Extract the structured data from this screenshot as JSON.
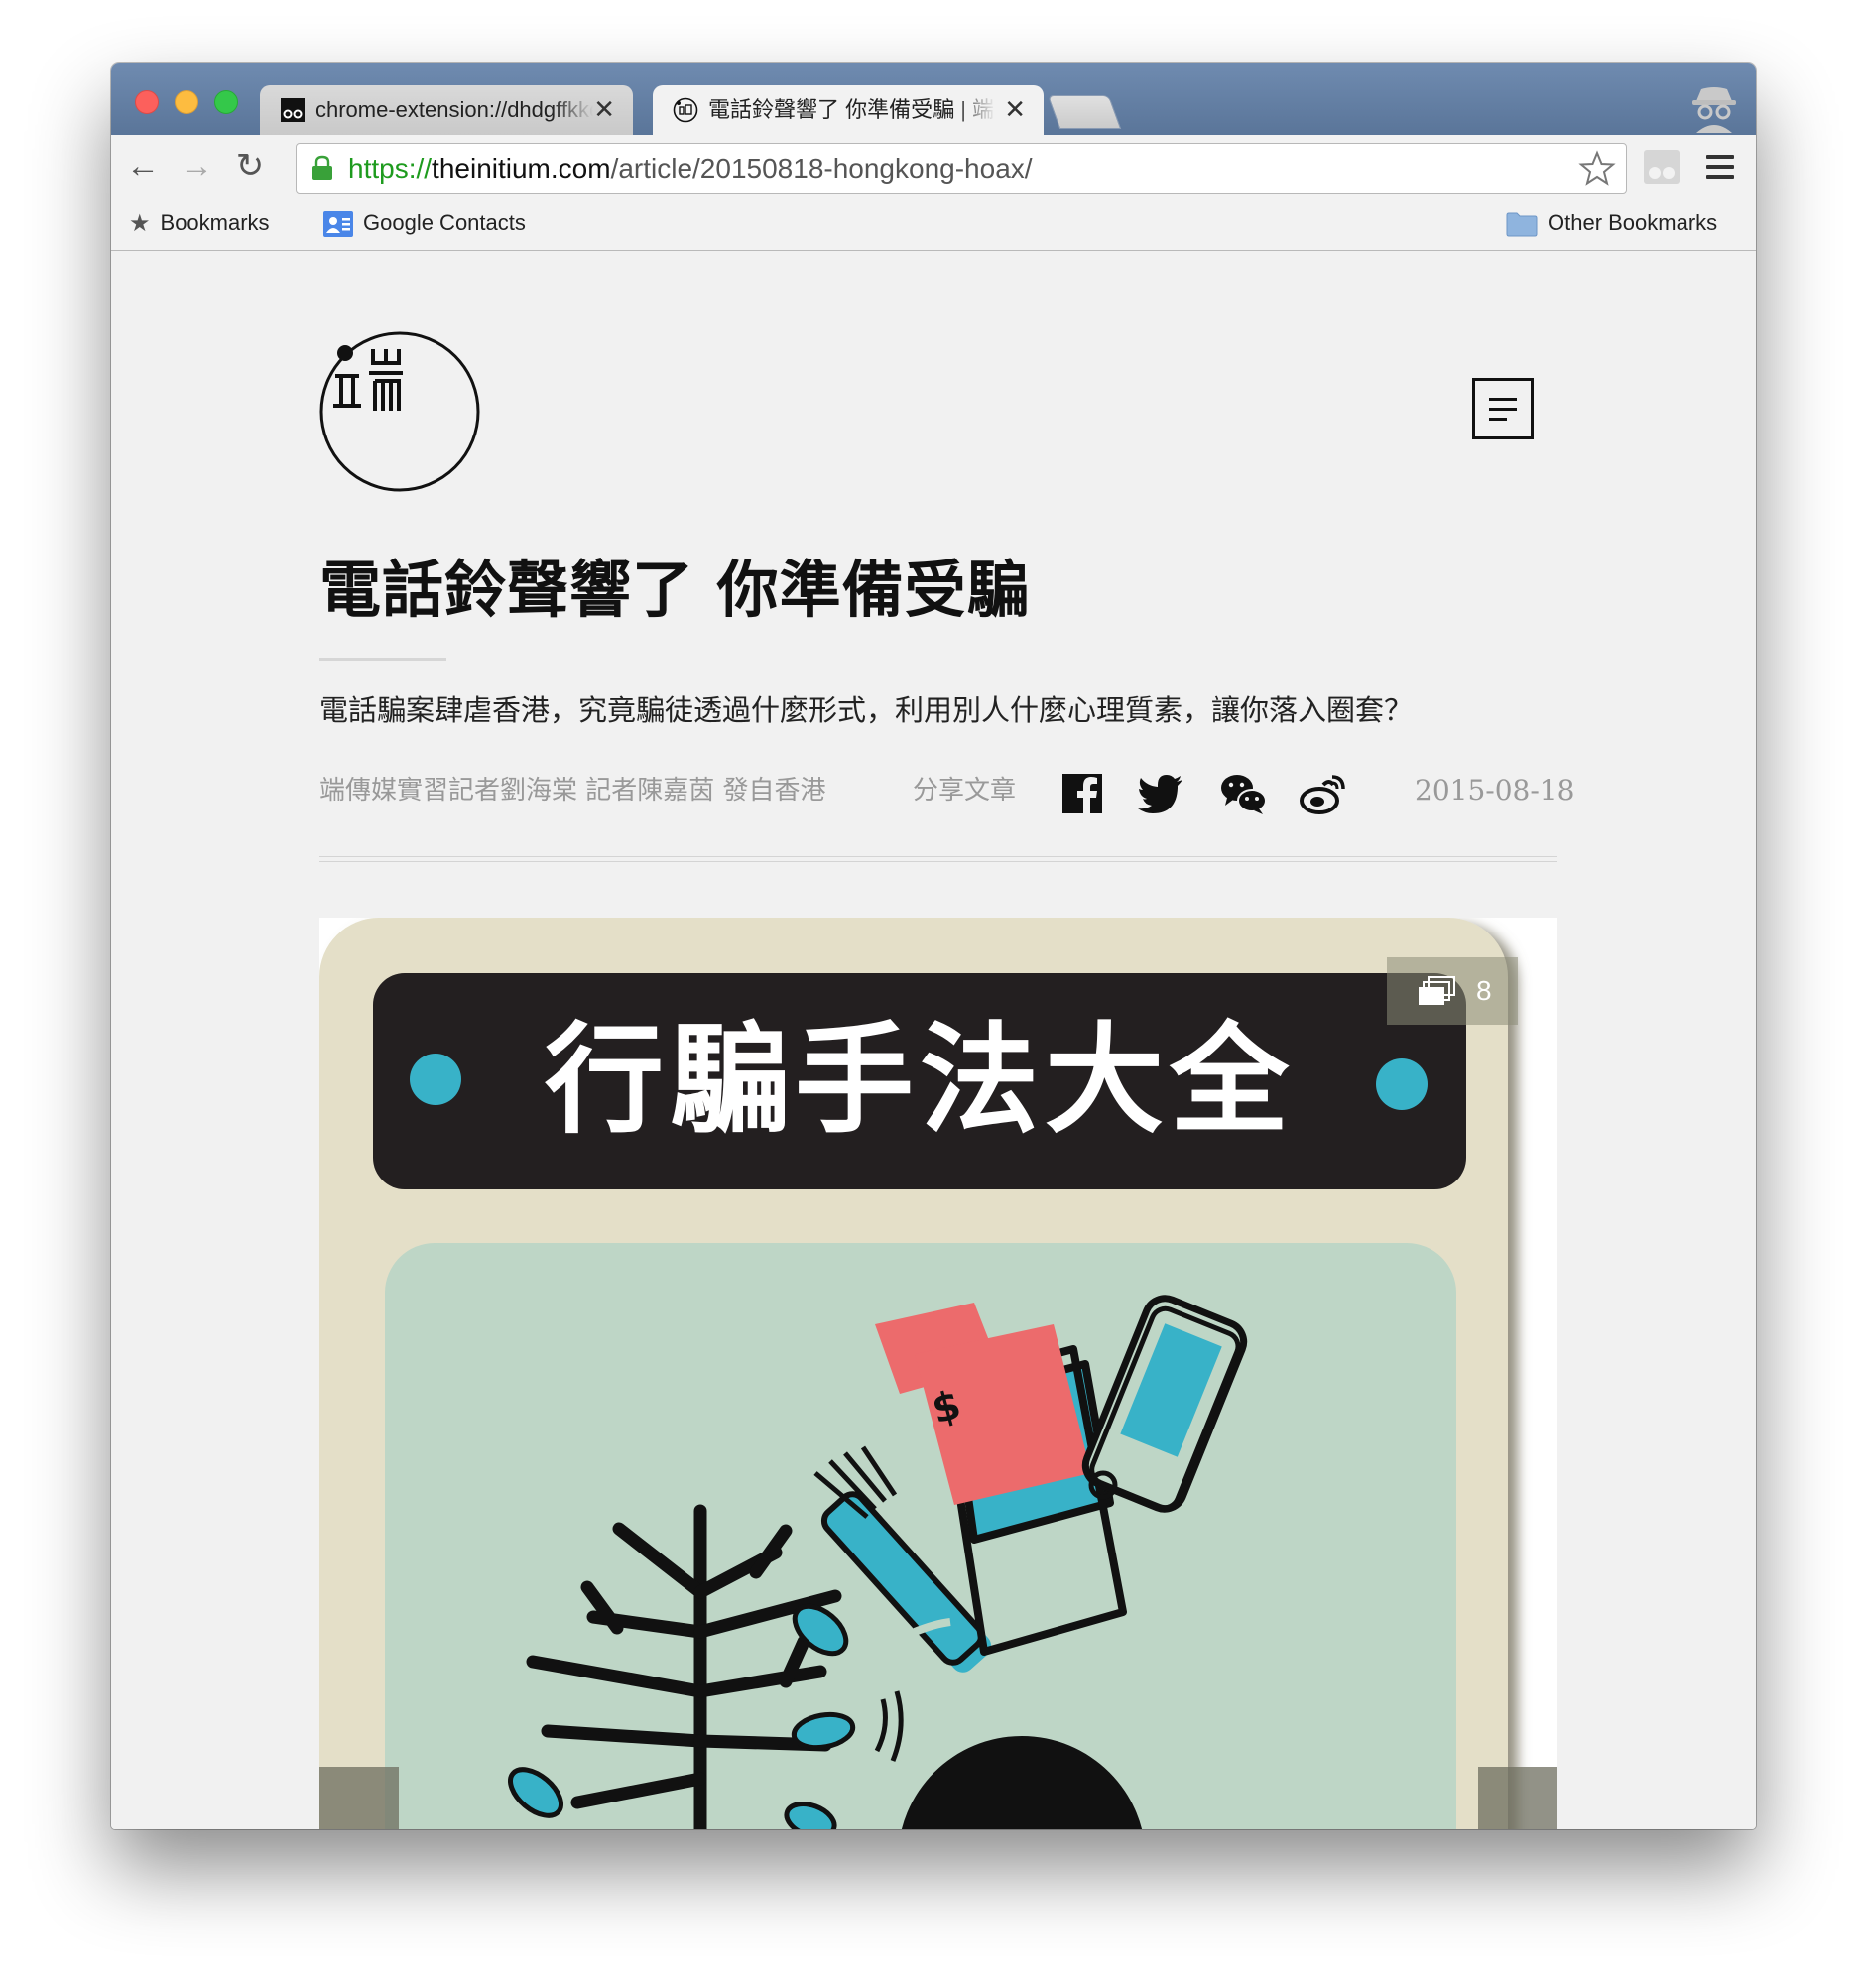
{
  "browser": {
    "tabs": [
      {
        "title": "chrome-extension://dhdgffkkebhmkfjojejmpbldmpobfkfo",
        "active": false
      },
      {
        "title": "電話鈴聲響了 你準備受騙 | 端",
        "active": true
      }
    ],
    "url": {
      "scheme": "https://",
      "host": "theinitium.com",
      "path": "/article/20150818-hongkong-hoax/"
    },
    "bookmarks": {
      "bookmarks_label": "Bookmarks",
      "google_contacts": "Google Contacts",
      "other_bookmarks": "Other Bookmarks"
    }
  },
  "article": {
    "title": "電話鈴聲響了 你準備受騙",
    "dek": "電話騙案肆虐香港，究竟騙徒透過什麼形式，利用別人什麼心理質素，讓你落入圈套？",
    "byline": "端傳媒實習記者劉海棠 記者陳嘉茵 發自香港",
    "share_label": "分享文章",
    "date": "2015-08-18",
    "social": [
      "facebook-icon",
      "twitter-icon",
      "wechat-icon",
      "weibo-icon"
    ]
  },
  "hero": {
    "banner_text": "行騙手法大全",
    "image_count": "8",
    "money_symbol": "$",
    "colors": {
      "card": "#e4dfc8",
      "banner": "#231f20",
      "panel": "#bed6c6",
      "teal": "#38b2c8",
      "coral": "#ec6b6c"
    }
  },
  "colors": {
    "tab_strip": "#6783a8",
    "url_scheme": "#1e9b1e",
    "page_bg": "#f1f1f1"
  }
}
